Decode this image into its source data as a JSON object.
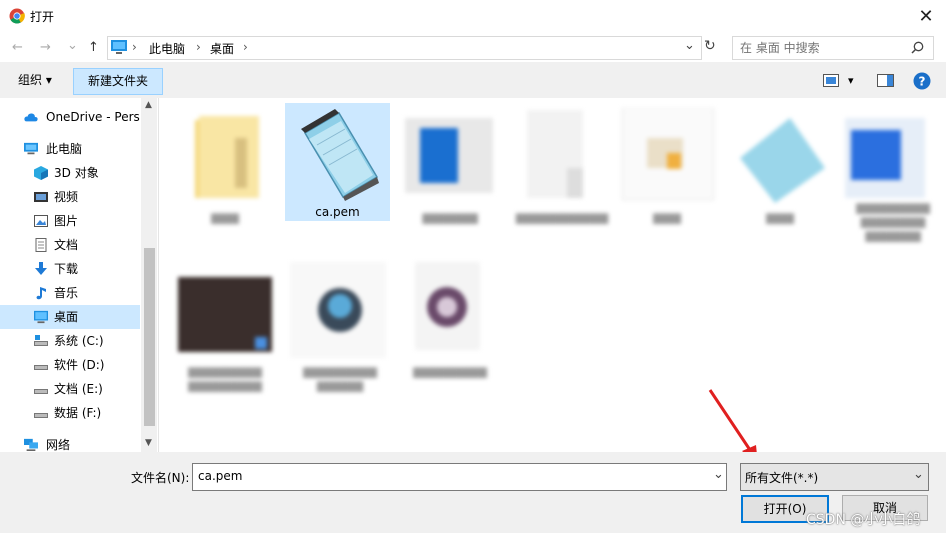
{
  "window": {
    "title": "打开",
    "close_glyph": "✕"
  },
  "nav": {
    "back": "←",
    "forward": "→",
    "recent": "⌄",
    "up": "↑",
    "breadcrumb": [
      "此电脑",
      "桌面"
    ],
    "sep": "›",
    "refresh": "↻",
    "dropdown": "⌄"
  },
  "search": {
    "placeholder": "在 桌面 中搜索"
  },
  "toolbar": {
    "organize_label": "组织 ▾",
    "new_folder_label": "新建文件夹",
    "view_toggle": "▾"
  },
  "sidebar": {
    "items": [
      {
        "label": "OneDrive - Perso",
        "icon": "cloud-icon"
      },
      {
        "label": "此电脑",
        "icon": "pc-icon"
      },
      {
        "label": "3D 对象",
        "icon": "cube-icon"
      },
      {
        "label": "视频",
        "icon": "video-icon"
      },
      {
        "label": "图片",
        "icon": "picture-icon"
      },
      {
        "label": "文档",
        "icon": "document-icon"
      },
      {
        "label": "下载",
        "icon": "download-icon"
      },
      {
        "label": "音乐",
        "icon": "music-icon"
      },
      {
        "label": "桌面",
        "icon": "desktop-icon"
      },
      {
        "label": "系统 (C:)",
        "icon": "drive-icon"
      },
      {
        "label": "软件 (D:)",
        "icon": "drive-icon"
      },
      {
        "label": "文档 (E:)",
        "icon": "drive-icon"
      },
      {
        "label": "数据 (F:)",
        "icon": "drive-icon"
      },
      {
        "label": "网络",
        "icon": "network-icon"
      }
    ],
    "selected": "桌面"
  },
  "files": {
    "ca_pem": "ca.pem"
  },
  "bottom": {
    "filename_label": "文件名(N):",
    "filename_value": "ca.pem",
    "filetype_value": "所有文件(*.*)",
    "open_label": "打开(O)",
    "cancel_label": "取消"
  },
  "watermark": "CSDN @小小白鸽",
  "colors": {
    "selection": "#cce8ff",
    "accent": "#0078d7",
    "arrow": "#e02020"
  }
}
